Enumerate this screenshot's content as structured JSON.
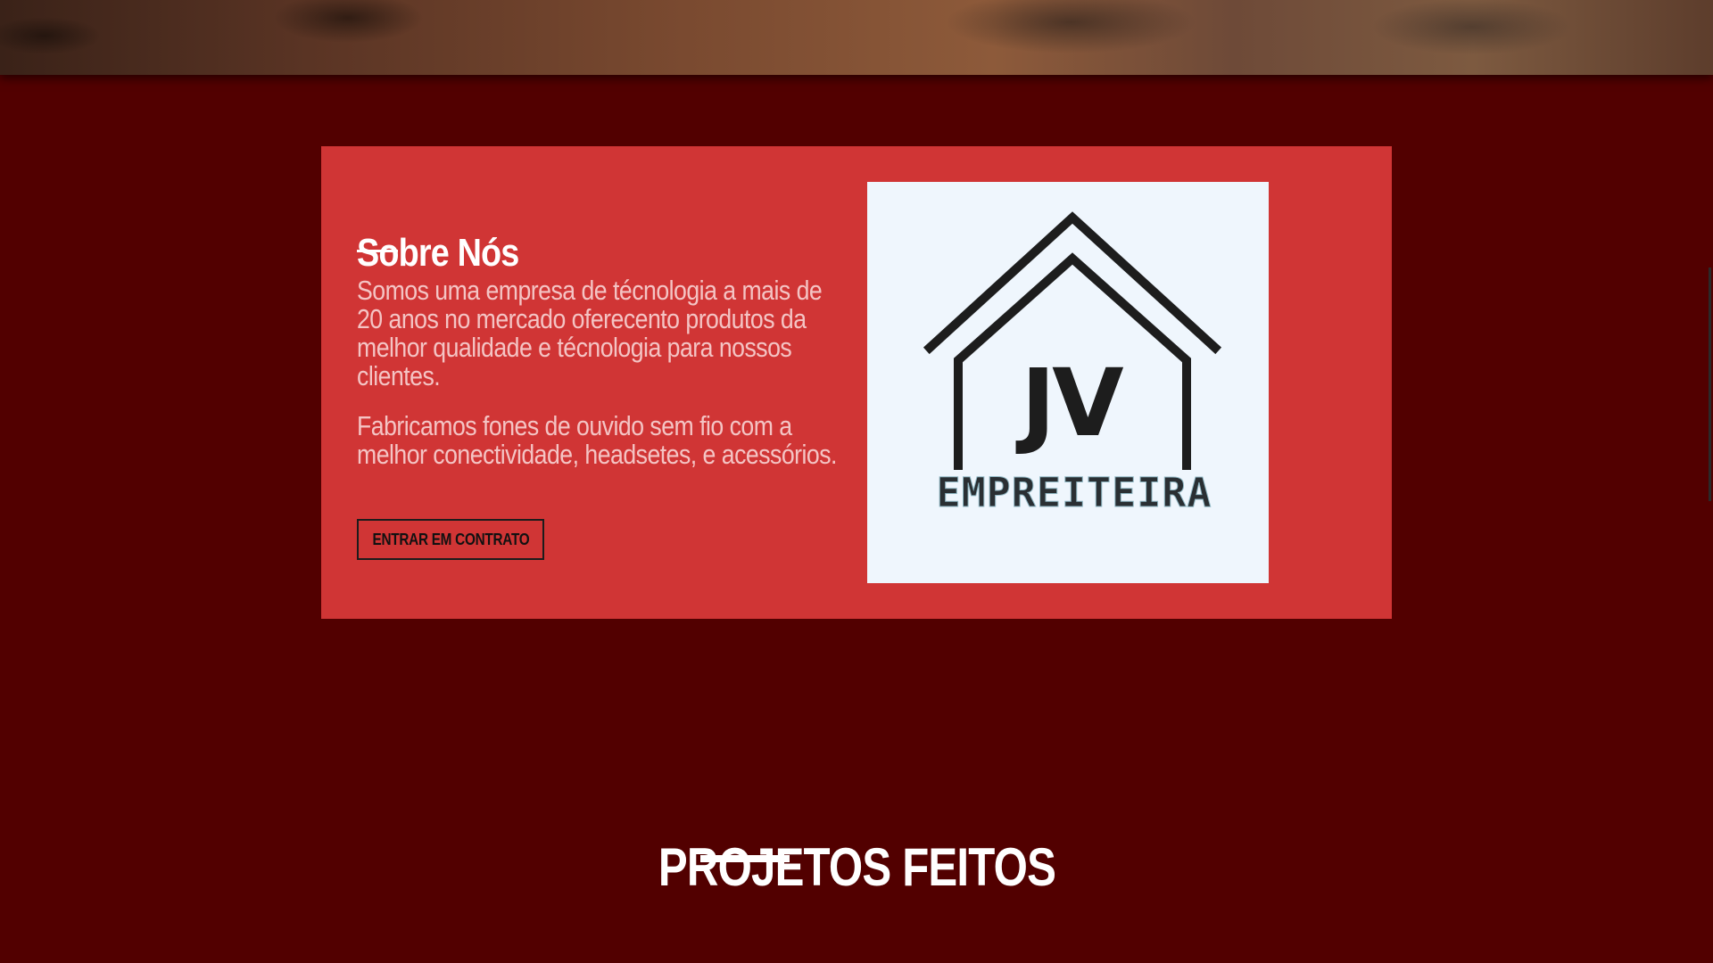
{
  "colors": {
    "page_background": "#520000",
    "card_background": "#d03535",
    "logo_background": "#eff6fd",
    "text_light": "#f4c4c4",
    "white": "#ffffff"
  },
  "about": {
    "title": "Sobre Nós",
    "paragraph_1": "Somos uma empresa de técnologia a mais de 20 anos no mercado oferecento produtos da melhor qualidade e técnologia para nossos clientes.",
    "paragraph_2": "Fabricamos fones de ouvido sem fio com a melhor conectividade, headsetes, e acessórios.",
    "button_label": "ENTRAR EM CONTRATO"
  },
  "logo": {
    "icon": "house-roof-logo",
    "mark": "JV",
    "subtitle": "EMPREITEIRA"
  },
  "projects": {
    "heading": "PROJETOS FEITOS"
  }
}
